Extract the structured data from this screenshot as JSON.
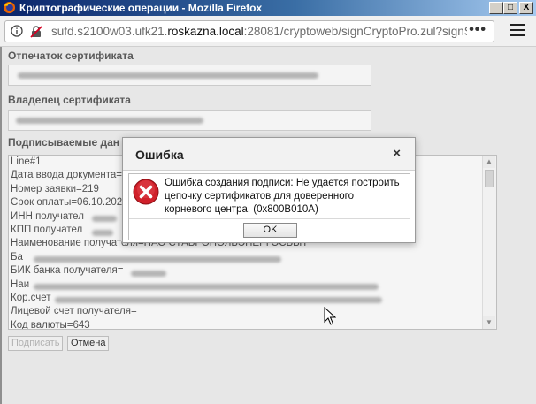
{
  "window": {
    "title": "Криптографические операции - Mozilla Firefox",
    "minimize": "_",
    "maximize": "□",
    "close": "X"
  },
  "nav": {
    "url_prefix": "sufd.s2100w03.ufk21.",
    "url_domain": "roskazna.local",
    "url_suffix": ":28081/cryptoweb/signCryptoPro.zul?signSes",
    "page_actions": "•••"
  },
  "form": {
    "cert_thumbprint_label": "Отпечаток сертификата",
    "cert_owner_label": "Владелец сертификата",
    "signed_data_label": "Подписываемые дан",
    "lines": [
      "Line#1",
      "Дата ввода документа=",
      "Номер заявки=219",
      "Срок оплаты=06.10.202",
      "ИНН получател",
      "КПП получател",
      "Наименование получателя=ПАО СТАВРОПОЛЬЭНЕРГОСБЫТ",
      "Ба",
      "БИК банка получателя=",
      "Наи",
      "Кор.счет",
      "Лицевой счет получателя=",
      "Код валюты=643"
    ],
    "sign_button": "Подписать",
    "cancel_button": "Отмена"
  },
  "dialog": {
    "title": "Ошибка",
    "close": "×",
    "message": "Ошибка создания подписи: Не удается построить цепочку сертификатов для доверенного корневого центра. (0x800B010A)",
    "ok": "OK"
  },
  "colors": {
    "titlebar": "#0a246a",
    "error_icon": "#d0202a"
  },
  "icons": [
    "firefox-icon",
    "info-icon",
    "lock-strike-icon",
    "hamburger-menu-icon",
    "error-icon",
    "mouse-cursor-icon"
  ]
}
